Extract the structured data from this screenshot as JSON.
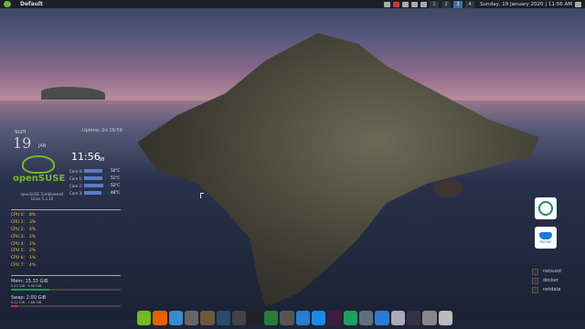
{
  "panel": {
    "title": "Default",
    "workspaces": [
      "1",
      "2",
      "3",
      "4"
    ],
    "active_workspace": "3",
    "clock": "Sunday, 19 January 2020 | 11:56 AM"
  },
  "conky": {
    "day": "sun",
    "date": "19",
    "month": "JAN",
    "uptime": "Uptime: 2d 19:59",
    "time": "11:56",
    "seconds": "38",
    "logo_text": "openSUSE",
    "distro_line1": "openSUSE Tumbleweed",
    "distro_line2": "Linux 5.x.16",
    "cores": [
      {
        "label": "Core 0:",
        "value": "50°C",
        "level": 0.5
      },
      {
        "label": "Core 1:",
        "value": "51°C",
        "level": 0.51
      },
      {
        "label": "Core 2:",
        "value": "52°C",
        "level": 0.52
      },
      {
        "label": "Core 3:",
        "value": "48°C",
        "level": 0.48
      }
    ],
    "cpus": [
      {
        "label": "CPU 0:",
        "value": "8%"
      },
      {
        "label": "CPU 1:",
        "value": "3%"
      },
      {
        "label": "CPU 2:",
        "value": "4%"
      },
      {
        "label": "CPU 3:",
        "value": "2%"
      },
      {
        "label": "CPU 4:",
        "value": "1%"
      },
      {
        "label": "CPU 5:",
        "value": "2%"
      },
      {
        "label": "CPU 6:",
        "value": "1%"
      },
      {
        "label": "CPU 7:",
        "value": "4%"
      }
    ],
    "mem": {
      "label": "Mem: 15.33 GiB",
      "used": "5.43 GiB",
      "free": "9.90 GiB",
      "level": 0.35
    },
    "swap": {
      "label": "Swap: 2.00 GiB",
      "used": "0.12 GiB",
      "free": "1.88 GiB",
      "level": 0.06
    }
  },
  "widgets": {
    "docker_label": "docker"
  },
  "services": [
    "netsusd",
    "docker",
    "netdata"
  ],
  "dock": [
    {
      "name": "suse-icon",
      "color": "#73ba25"
    },
    {
      "name": "firefox-icon",
      "color": "#e66000"
    },
    {
      "name": "files-icon",
      "color": "#3b8ad0"
    },
    {
      "name": "hardinfo-icon",
      "color": "#666"
    },
    {
      "name": "gimp-icon",
      "color": "#6b5a3a"
    },
    {
      "name": "steam-icon",
      "color": "#2b4a6e"
    },
    {
      "name": "vlc-icon",
      "color": "#444"
    },
    {
      "name": "terminal-icon",
      "color": "#222"
    },
    {
      "name": "suse-app-icon",
      "color": "#2a7a3a"
    },
    {
      "name": "system-monitor-icon",
      "color": "#555"
    },
    {
      "name": "vs-icon",
      "color": "#2a7bd3"
    },
    {
      "name": "vscode-icon",
      "color": "#1e88e5"
    },
    {
      "name": "slack-icon",
      "color": "#3e1b42"
    },
    {
      "name": "whatsapp-icon",
      "color": "#1ea15a"
    },
    {
      "name": "gear-icon",
      "color": "#607080"
    },
    {
      "name": "box-icon",
      "color": "#2d7bd3"
    },
    {
      "name": "settings-icon",
      "color": "#aab"
    },
    {
      "name": "window-icon",
      "color": "#334"
    },
    {
      "name": "screenshot-icon",
      "color": "#888"
    },
    {
      "name": "trash-icon",
      "color": "#bbb"
    }
  ]
}
